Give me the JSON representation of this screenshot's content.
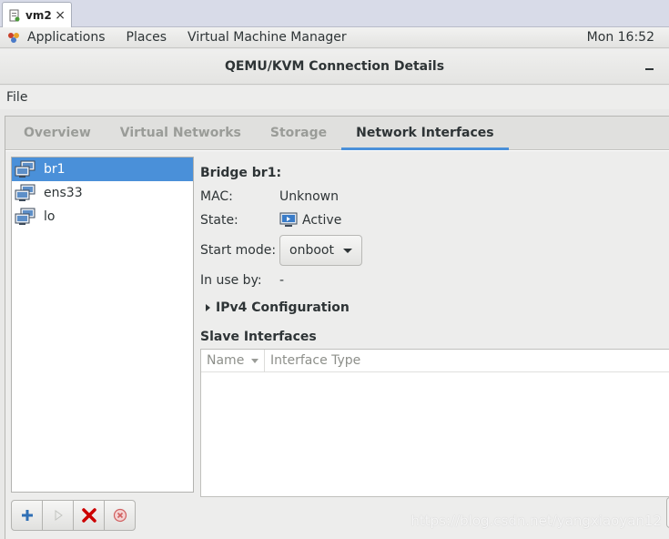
{
  "browser_tab": {
    "title": "vm2",
    "close_glyph": "×",
    "icon": "document-icon"
  },
  "panel": {
    "applications": "Applications",
    "places": "Places",
    "vmm": "Virtual Machine Manager",
    "clock": "Mon 16:52"
  },
  "window": {
    "title": "QEMU/KVM Connection Details"
  },
  "menu": {
    "file": "File"
  },
  "tabs": [
    {
      "label": "Overview",
      "active": false
    },
    {
      "label": "Virtual Networks",
      "active": false
    },
    {
      "label": "Storage",
      "active": false
    },
    {
      "label": "Network Interfaces",
      "active": true
    }
  ],
  "interfaces": [
    {
      "name": "br1",
      "selected": true,
      "icon": "network-icon"
    },
    {
      "name": "ens33",
      "selected": false,
      "icon": "network-icon"
    },
    {
      "name": "lo",
      "selected": false,
      "icon": "network-icon"
    }
  ],
  "details": {
    "heading": "Bridge br1:",
    "mac_label": "MAC:",
    "mac_value": "Unknown",
    "state_label": "State:",
    "state_value": "Active",
    "start_mode_label": "Start mode:",
    "start_mode_value": "onboot",
    "in_use_label": "In use by:",
    "in_use_value": "-",
    "ipv4_label": "IPv4 Configuration",
    "slave_heading": "Slave Interfaces",
    "col_name": "Name",
    "col_type": "Interface Type"
  },
  "toolbar": {
    "add": "add-icon",
    "start": "play-icon",
    "delete": "delete-icon",
    "stop": "stop-icon"
  },
  "watermark": "https://blog.csdn.net/yangxiaoyan12",
  "colors": {
    "accent": "#4a90d9",
    "delete": "#cc0000"
  }
}
